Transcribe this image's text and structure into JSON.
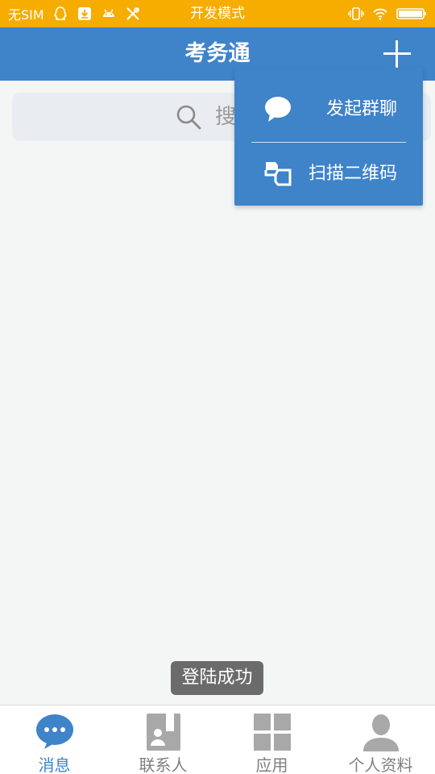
{
  "status_bar": {
    "carrier": "无SIM",
    "mode": "开发模式"
  },
  "header": {
    "title": "考务通"
  },
  "search": {
    "placeholder": "搜"
  },
  "menu": {
    "items": [
      {
        "label": "发起群聊",
        "icon": "chat-bubble-icon"
      },
      {
        "label": "扫描二维码",
        "icon": "qr-scan-icon"
      }
    ]
  },
  "toast": {
    "text": "登陆成功"
  },
  "bottom_nav": {
    "tabs": [
      {
        "label": "消息",
        "icon": "message-icon",
        "active": true
      },
      {
        "label": "联系人",
        "icon": "contacts-icon",
        "active": false
      },
      {
        "label": "应用",
        "icon": "apps-grid-icon",
        "active": false
      },
      {
        "label": "个人资料",
        "icon": "profile-icon",
        "active": false
      }
    ]
  },
  "colors": {
    "status_bar": "#f7ac00",
    "primary": "#3f83c9",
    "background": "#f4f6f6",
    "inactive": "#7f7f7f"
  }
}
